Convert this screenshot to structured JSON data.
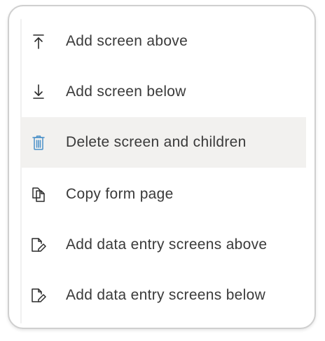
{
  "menu": {
    "items": [
      {
        "label": "Add screen above",
        "icon": "arrow-up-to-line-icon",
        "highlighted": false
      },
      {
        "label": "Add screen below",
        "icon": "arrow-down-to-line-icon",
        "highlighted": false
      },
      {
        "label": "Delete screen and children",
        "icon": "trash-icon",
        "highlighted": true
      },
      {
        "label": "Copy form page",
        "icon": "copy-icon",
        "highlighted": false
      },
      {
        "label": "Add data entry screens above",
        "icon": "file-edit-icon",
        "highlighted": false
      },
      {
        "label": "Add data entry screens below",
        "icon": "file-edit-icon",
        "highlighted": false
      }
    ]
  },
  "colors": {
    "text": "#3a3a3a",
    "icon": "#2b2b2b",
    "delete_icon": "#4a90c8",
    "highlight_bg": "#f2f1ef",
    "border": "#cfcfcf"
  }
}
